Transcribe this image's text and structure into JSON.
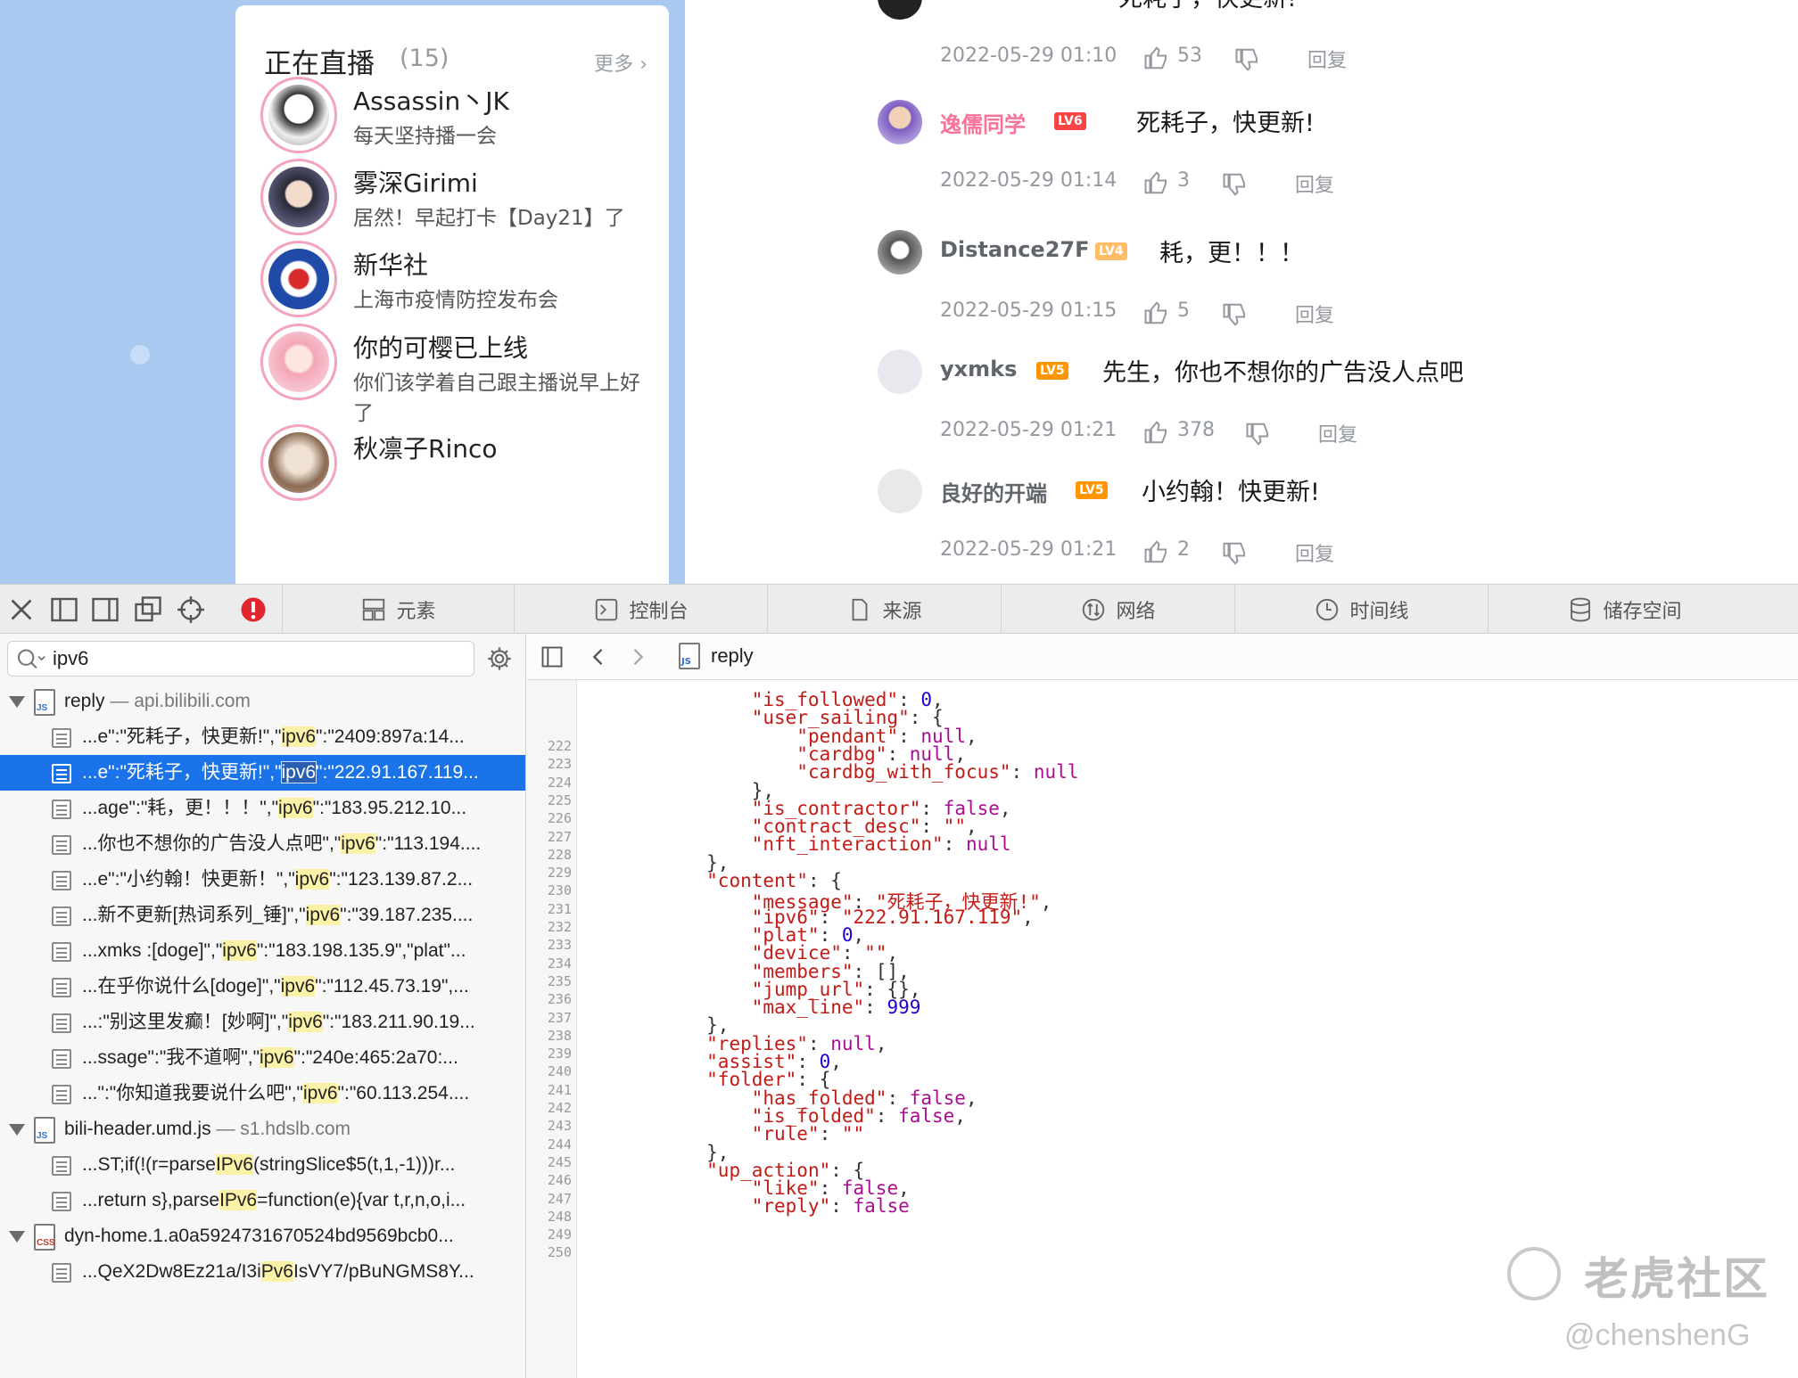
{
  "live": {
    "title": "正在直播",
    "count": "(15)",
    "more": "更多",
    "streamers": [
      {
        "name": "Assassin丶JK",
        "desc": "每天坚持播一会"
      },
      {
        "name": "雾深Girimi",
        "desc": "居然！早起打卡【Day21】了"
      },
      {
        "name": "新华社",
        "desc": "上海市疫情防控发布会"
      },
      {
        "name": "你的可樱已上线",
        "desc": "你们该学着自己跟主播说早上好了"
      },
      {
        "name": "秋凛子Rinco",
        "desc": ""
      }
    ]
  },
  "comments": [
    {
      "user": "",
      "level": "",
      "text": "死耗子，快更新!",
      "time": "2022-05-29 01:10",
      "likes": "53",
      "reply": "回复"
    },
    {
      "user": "逸儒同学",
      "level": "LV6",
      "text": "死耗子，快更新!",
      "time": "2022-05-29 01:14",
      "likes": "3",
      "reply": "回复"
    },
    {
      "user": "Distance27F",
      "level": "LV4",
      "text": "耗，更！！！",
      "time": "2022-05-29 01:15",
      "likes": "5",
      "reply": "回复"
    },
    {
      "user": "yxmks",
      "level": "LV5",
      "text": "先生，你也不想你的广告没人点吧",
      "time": "2022-05-29 01:21",
      "likes": "378",
      "reply": "回复"
    },
    {
      "user": "良好的开端",
      "level": "LV5",
      "text": "小约翰！快更新!",
      "time": "2022-05-29 01:21",
      "likes": "2",
      "reply": "回复"
    }
  ],
  "devtools": {
    "tabs": [
      "元素",
      "控制台",
      "来源",
      "网络",
      "时间线",
      "储存空间"
    ],
    "search": {
      "value": "ipv6"
    },
    "tree": [
      {
        "kind": "file",
        "type": "JS",
        "name": "reply",
        "host": "— api.bilibili.com"
      },
      {
        "kind": "result",
        "pre": "...e\":\"死耗子，快更新!\",\"",
        "match": "ipv6",
        "post": "\":\"2409:897a:14..."
      },
      {
        "kind": "result",
        "pre": "...e\":\"死耗子，快更新!\",\"",
        "match": "ipv6",
        "post": "\":\"222.91.167.119...",
        "selected": true
      },
      {
        "kind": "result",
        "pre": "...age\":\"耗，更！！！\",\"",
        "match": "ipv6",
        "post": "\":\"183.95.212.10..."
      },
      {
        "kind": "result",
        "pre": "...你也不想你的广告没人点吧\",\"",
        "match": "ipv6",
        "post": "\":\"113.194...."
      },
      {
        "kind": "result",
        "pre": "...e\":\"小约翰！快更新！\",\"",
        "match": "ipv6",
        "post": "\":\"123.139.87.2..."
      },
      {
        "kind": "result",
        "pre": "...新不更新[热词系列_锤]\",\"",
        "match": "ipv6",
        "post": "\":\"39.187.235...."
      },
      {
        "kind": "result",
        "pre": "...xmks :[doge]\",\"",
        "match": "ipv6",
        "post": "\":\"183.198.135.9\",\"plat\"..."
      },
      {
        "kind": "result",
        "pre": "...在乎你说什么[doge]\",\"",
        "match": "ipv6",
        "post": "\":\"112.45.73.19\",..."
      },
      {
        "kind": "result",
        "pre": "...:\"别这里发癫！[妙啊]\",\"",
        "match": "ipv6",
        "post": "\":\"183.211.90.19..."
      },
      {
        "kind": "result",
        "pre": "...ssage\":\"我不道啊\",\"",
        "match": "ipv6",
        "post": "\":\"240e:465:2a70:..."
      },
      {
        "kind": "result",
        "pre": "...\":\"你知道我要说什么吧\",\"",
        "match": "ipv6",
        "post": "\":\"60.113.254...."
      },
      {
        "kind": "file",
        "type": "JS",
        "name": "bili-header.umd.js",
        "host": "— s1.hdslb.com"
      },
      {
        "kind": "result",
        "pre": "...ST;if(!(r=parse",
        "match": "IPv6",
        "post": "(stringSlice$5(t,1,-1)))r..."
      },
      {
        "kind": "result",
        "pre": "...return s},parse",
        "match": "IPv6",
        "post": "=function(e){var t,r,n,o,i..."
      },
      {
        "kind": "file",
        "type": "CSS",
        "name": "dyn-home.1.a0a5924731670524bd9569bcb0...",
        "host": ""
      },
      {
        "kind": "result",
        "pre": "...QeX2Dw8Ez21a/I3i",
        "match": "Pv6",
        "post": "IsVY7/pBuNGMS8Y..."
      }
    ],
    "editor": {
      "filename": "reply",
      "lines": [
        {
          "no": "222",
          "code": "            <k>\"is_followed\"</k>: <n>0</n>,"
        },
        {
          "no": "223",
          "code": "            <k>\"user_sailing\"</k>: {"
        },
        {
          "no": "224",
          "code": "                <k>\"pendant\"</k>: <b>null</b>,"
        },
        {
          "no": "225",
          "code": "                <k>\"cardbg\"</k>: <b>null</b>,"
        },
        {
          "no": "226",
          "code": "                <k>\"cardbg_with_focus\"</k>: <b>null</b>"
        },
        {
          "no": "227",
          "code": "            },"
        },
        {
          "no": "228",
          "code": "            <k>\"is_contractor\"</k>: <b>false</b>,"
        },
        {
          "no": "229",
          "code": "            <k>\"contract_desc\"</k>: <s>\"\"</s>,"
        },
        {
          "no": "230",
          "code": "            <k>\"nft_interaction\"</k>: <b>null</b>"
        },
        {
          "no": "231",
          "code": "        },"
        },
        {
          "no": "232",
          "code": "        <k>\"content\"</k>: {"
        },
        {
          "no": "233",
          "code": "            <k>\"message\"</k>: <s>\"死耗子，快更新!\"</s>,"
        },
        {
          "no": "234",
          "code": "            <k>\"ipv6\"</k>: <s>\"222.91.167.119\"</s>,"
        },
        {
          "no": "235",
          "code": "            <k>\"plat\"</k>: <n>0</n>,"
        },
        {
          "no": "236",
          "code": "            <k>\"device\"</k>: <s>\"\"</s>,"
        },
        {
          "no": "237",
          "code": "            <k>\"members\"</k>: [],"
        },
        {
          "no": "238",
          "code": "            <k>\"jump_url\"</k>: {},"
        },
        {
          "no": "239",
          "code": "            <k>\"max_line\"</k>: <n>999</n>"
        },
        {
          "no": "240",
          "code": "        },"
        },
        {
          "no": "241",
          "code": "        <k>\"replies\"</k>: <b>null</b>,"
        },
        {
          "no": "242",
          "code": "        <k>\"assist\"</k>: <n>0</n>,"
        },
        {
          "no": "243",
          "code": "        <k>\"folder\"</k>: {"
        },
        {
          "no": "244",
          "code": "            <k>\"has_folded\"</k>: <b>false</b>,"
        },
        {
          "no": "245",
          "code": "            <k>\"is_folded\"</k>: <b>false</b>,"
        },
        {
          "no": "246",
          "code": "            <k>\"rule\"</k>: <s>\"\"</s>"
        },
        {
          "no": "247",
          "code": "        },"
        },
        {
          "no": "248",
          "code": "        <k>\"up_action\"</k>: {"
        },
        {
          "no": "249",
          "code": "            <k>\"like\"</k>: <b>false</b>,"
        },
        {
          "no": "250",
          "code": "            <k>\"reply\"</k>: <b>false</b>"
        }
      ]
    }
  },
  "watermark": {
    "brand": "老虎社区",
    "user": "@chenshenG"
  },
  "colors": {
    "accent": "#1a73e8",
    "pink": "#fb7299",
    "lv6": "#fb4444",
    "lv5": "#ff9500",
    "lv4": "#ffbd6a"
  }
}
